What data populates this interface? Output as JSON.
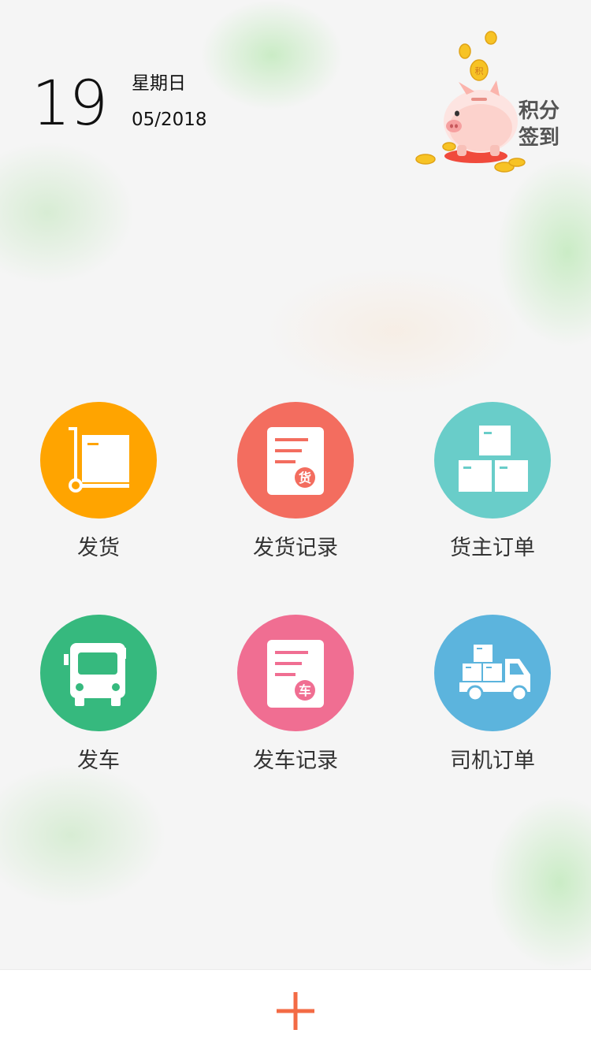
{
  "header": {
    "day": "19",
    "weekday": "星期日",
    "month_year": "05/2018"
  },
  "checkin": {
    "label_line1": "积分",
    "label_line2": "签到",
    "coin_char": "积"
  },
  "colors": {
    "ship": "#ffa400",
    "ship_records": "#f36d5f",
    "shipper_orders": "#69cdc9",
    "dispatch": "#36b97e",
    "dispatch_records": "#f06e92",
    "driver_orders": "#5cb4dd",
    "add_button": "#f36b45"
  },
  "grid": [
    {
      "label": "发货",
      "icon": "cart-box-icon"
    },
    {
      "label": "发货记录",
      "icon": "cargo-record-icon",
      "badge": "货"
    },
    {
      "label": "货主订单",
      "icon": "stacked-boxes-icon"
    },
    {
      "label": "发车",
      "icon": "truck-front-icon"
    },
    {
      "label": "发车记录",
      "icon": "vehicle-record-icon",
      "badge": "车"
    },
    {
      "label": "司机订单",
      "icon": "delivery-truck-icon"
    }
  ],
  "bottom": {
    "add_icon": "plus-icon"
  }
}
